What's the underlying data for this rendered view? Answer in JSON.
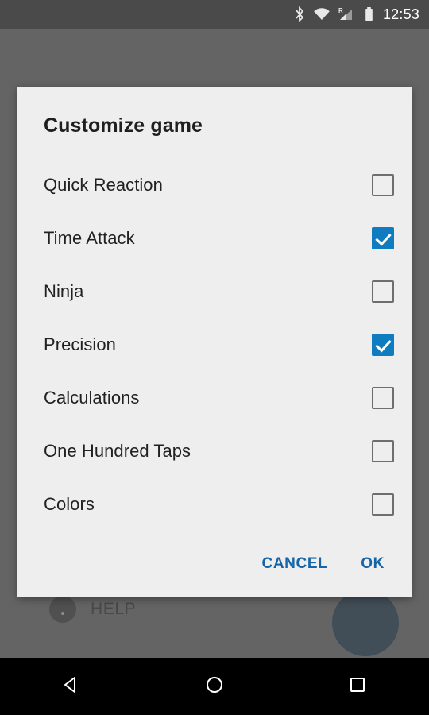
{
  "status_bar": {
    "time": "12:53",
    "icons": [
      {
        "name": "bluetooth-icon",
        "label": "Bluetooth"
      },
      {
        "name": "wifi-icon",
        "label": "Wi-Fi"
      },
      {
        "name": "cellular-roaming-icon",
        "label": "R"
      },
      {
        "name": "battery-icon",
        "label": "Battery"
      }
    ],
    "background_color": "#4a4a4a",
    "foreground_color": "#ffffff"
  },
  "background_app": {
    "help_label": "HELP",
    "help_icon": "info-circle-icon",
    "fab_icon": "fab-action-icon",
    "fab_color": "#15334d"
  },
  "dialog": {
    "title": "Customize game",
    "background_color": "#eeeeee",
    "accent_color": "#0f7cc0",
    "button_color": "#1565a8",
    "options": [
      {
        "label": "Quick Reaction",
        "checked": false
      },
      {
        "label": "Time Attack",
        "checked": true
      },
      {
        "label": "Ninja",
        "checked": false
      },
      {
        "label": "Precision",
        "checked": true
      },
      {
        "label": "Calculations",
        "checked": false
      },
      {
        "label": "One Hundred Taps",
        "checked": false
      },
      {
        "label": "Colors",
        "checked": false
      }
    ],
    "cancel_label": "CANCEL",
    "ok_label": "OK"
  },
  "nav_bar": {
    "back_label": "Back",
    "home_label": "Home",
    "recents_label": "Recents",
    "background_color": "#000000"
  }
}
